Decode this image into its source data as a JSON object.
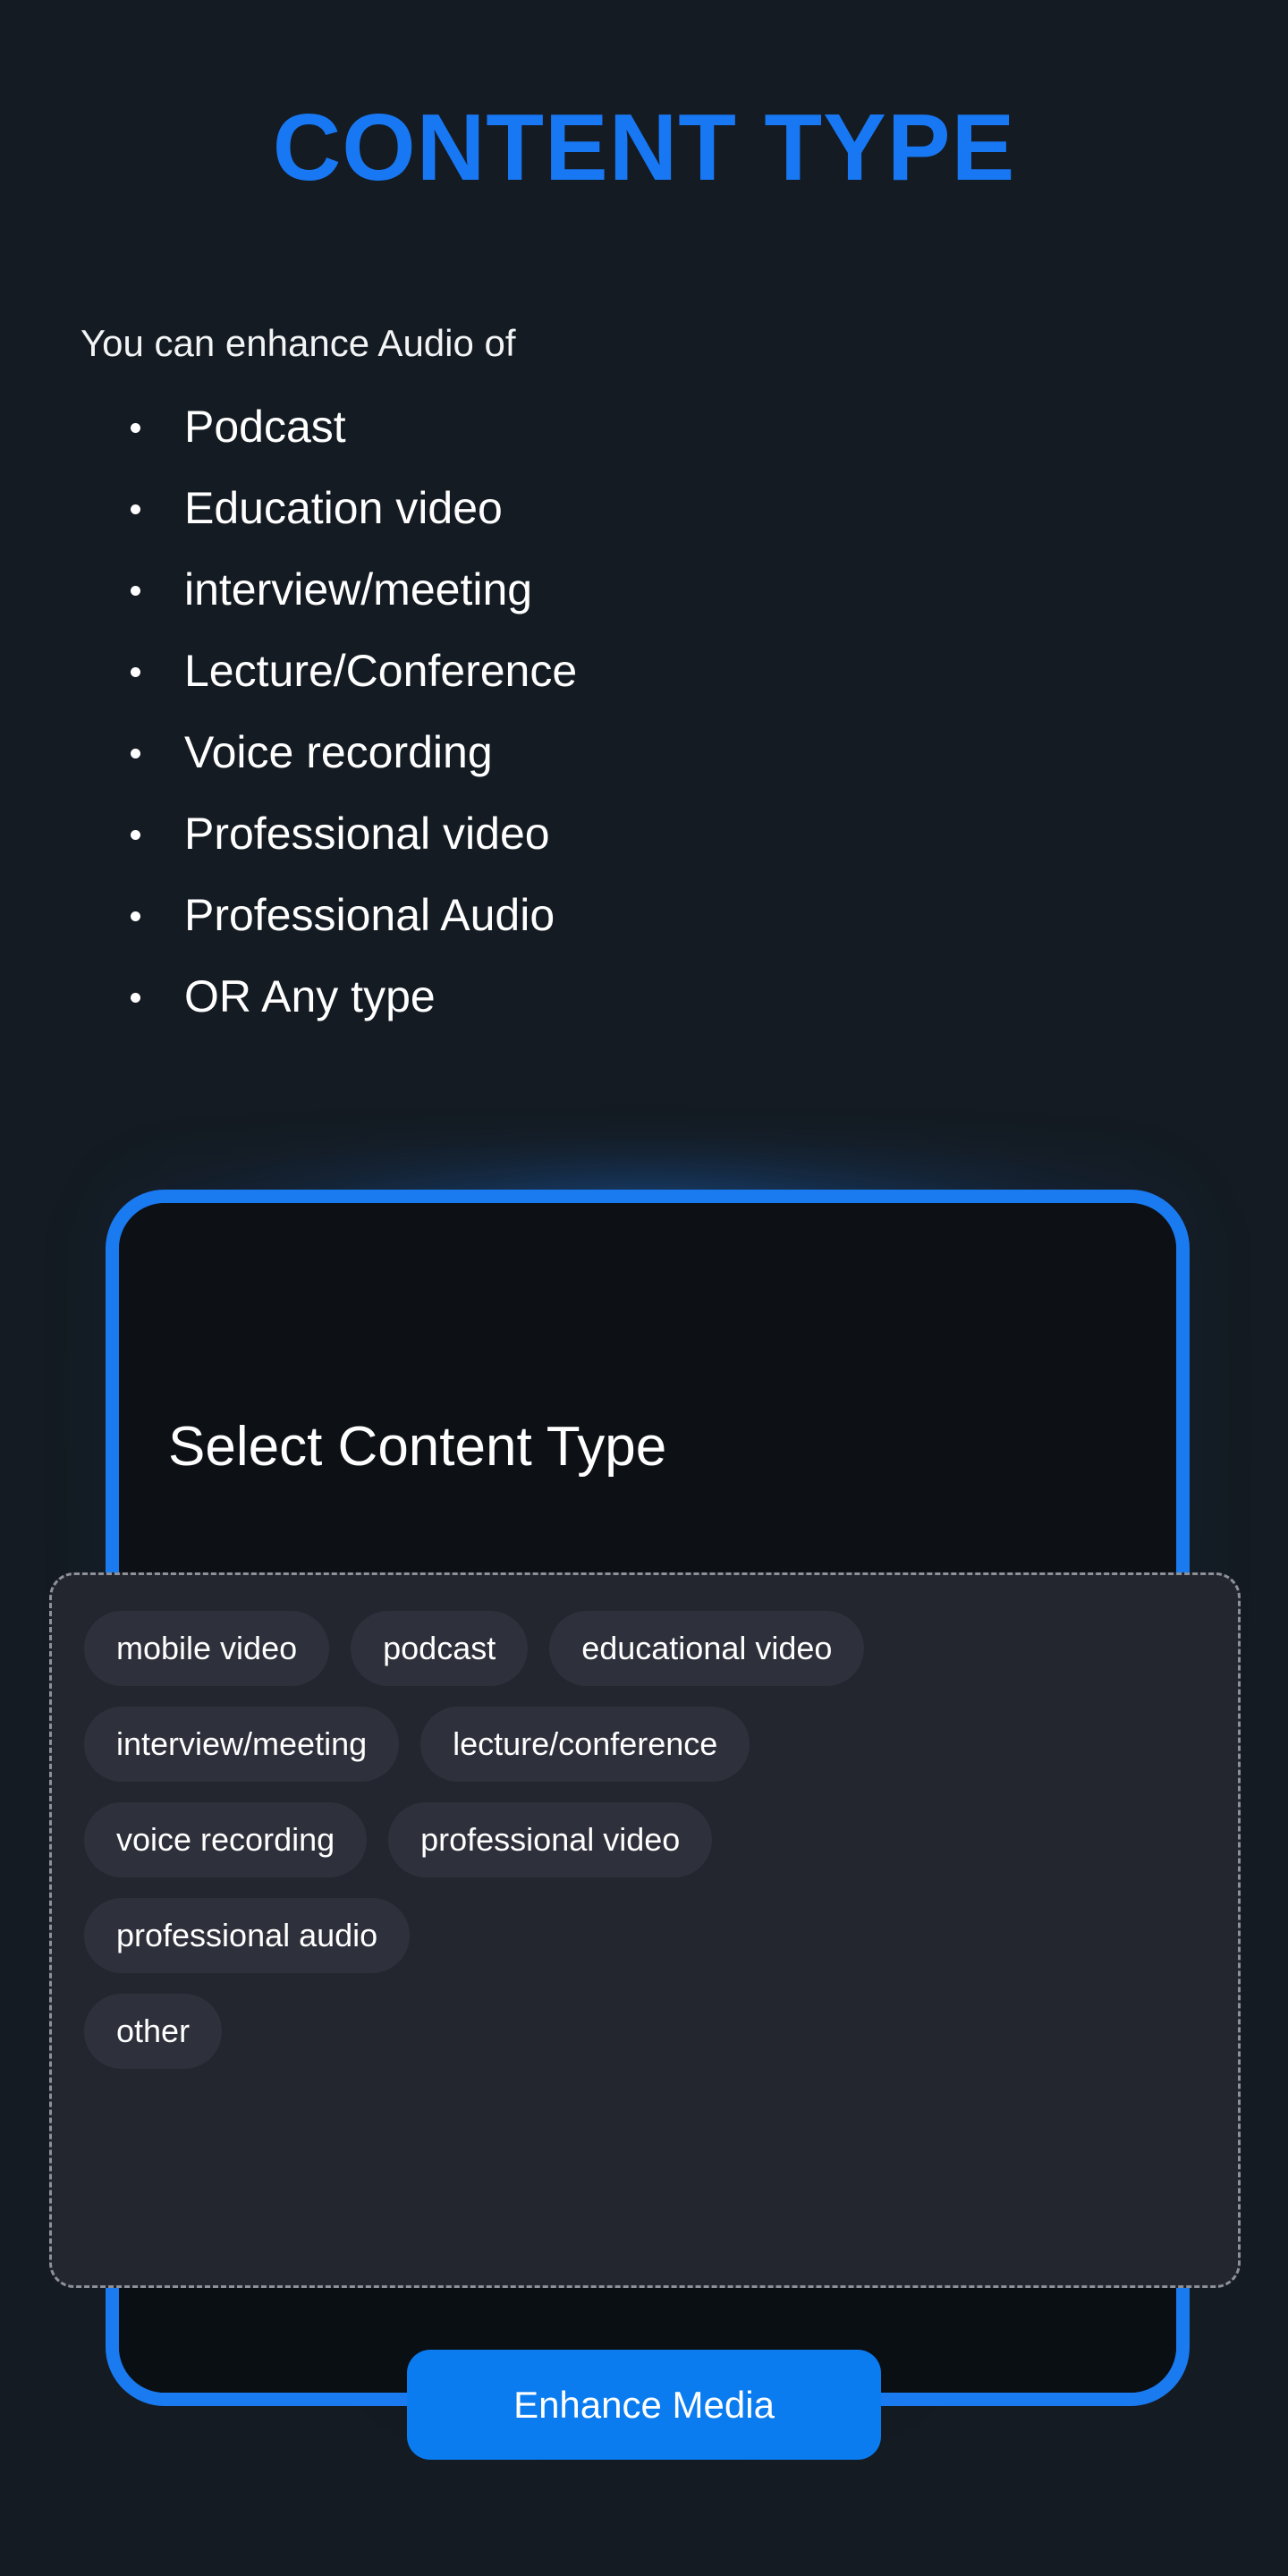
{
  "page": {
    "title": "CONTENT TYPE",
    "background_color": "#141b22",
    "accent_color": "#1877f2"
  },
  "intro": {
    "text": "You can enhance Audio of"
  },
  "bullets": [
    {
      "label": "Podcast"
    },
    {
      "label": "Education video"
    },
    {
      "label": "interview/meeting"
    },
    {
      "label": "Lecture/Conference"
    },
    {
      "label": "Voice recording"
    },
    {
      "label": "Professional video"
    },
    {
      "label": "Professional Audio"
    },
    {
      "label": "OR Any type"
    }
  ],
  "phone": {
    "frame_color": "#1a7af0",
    "screen": {
      "heading": "Select Content Type"
    }
  },
  "chips_panel": {
    "border_style": "dashed",
    "border_color": "#8d9199",
    "background_color": "#23252f",
    "rows": [
      [
        {
          "label": "mobile video"
        },
        {
          "label": "podcast"
        },
        {
          "label": "educational video"
        }
      ],
      [
        {
          "label": "interview/meeting"
        },
        {
          "label": "lecture/conference"
        }
      ],
      [
        {
          "label": "voice recording"
        },
        {
          "label": "professional video"
        }
      ],
      [
        {
          "label": "professional audio"
        }
      ],
      [
        {
          "label": "other"
        }
      ]
    ]
  },
  "primary_action": {
    "label": "Enhance Media",
    "color": "#0a7cf0"
  }
}
